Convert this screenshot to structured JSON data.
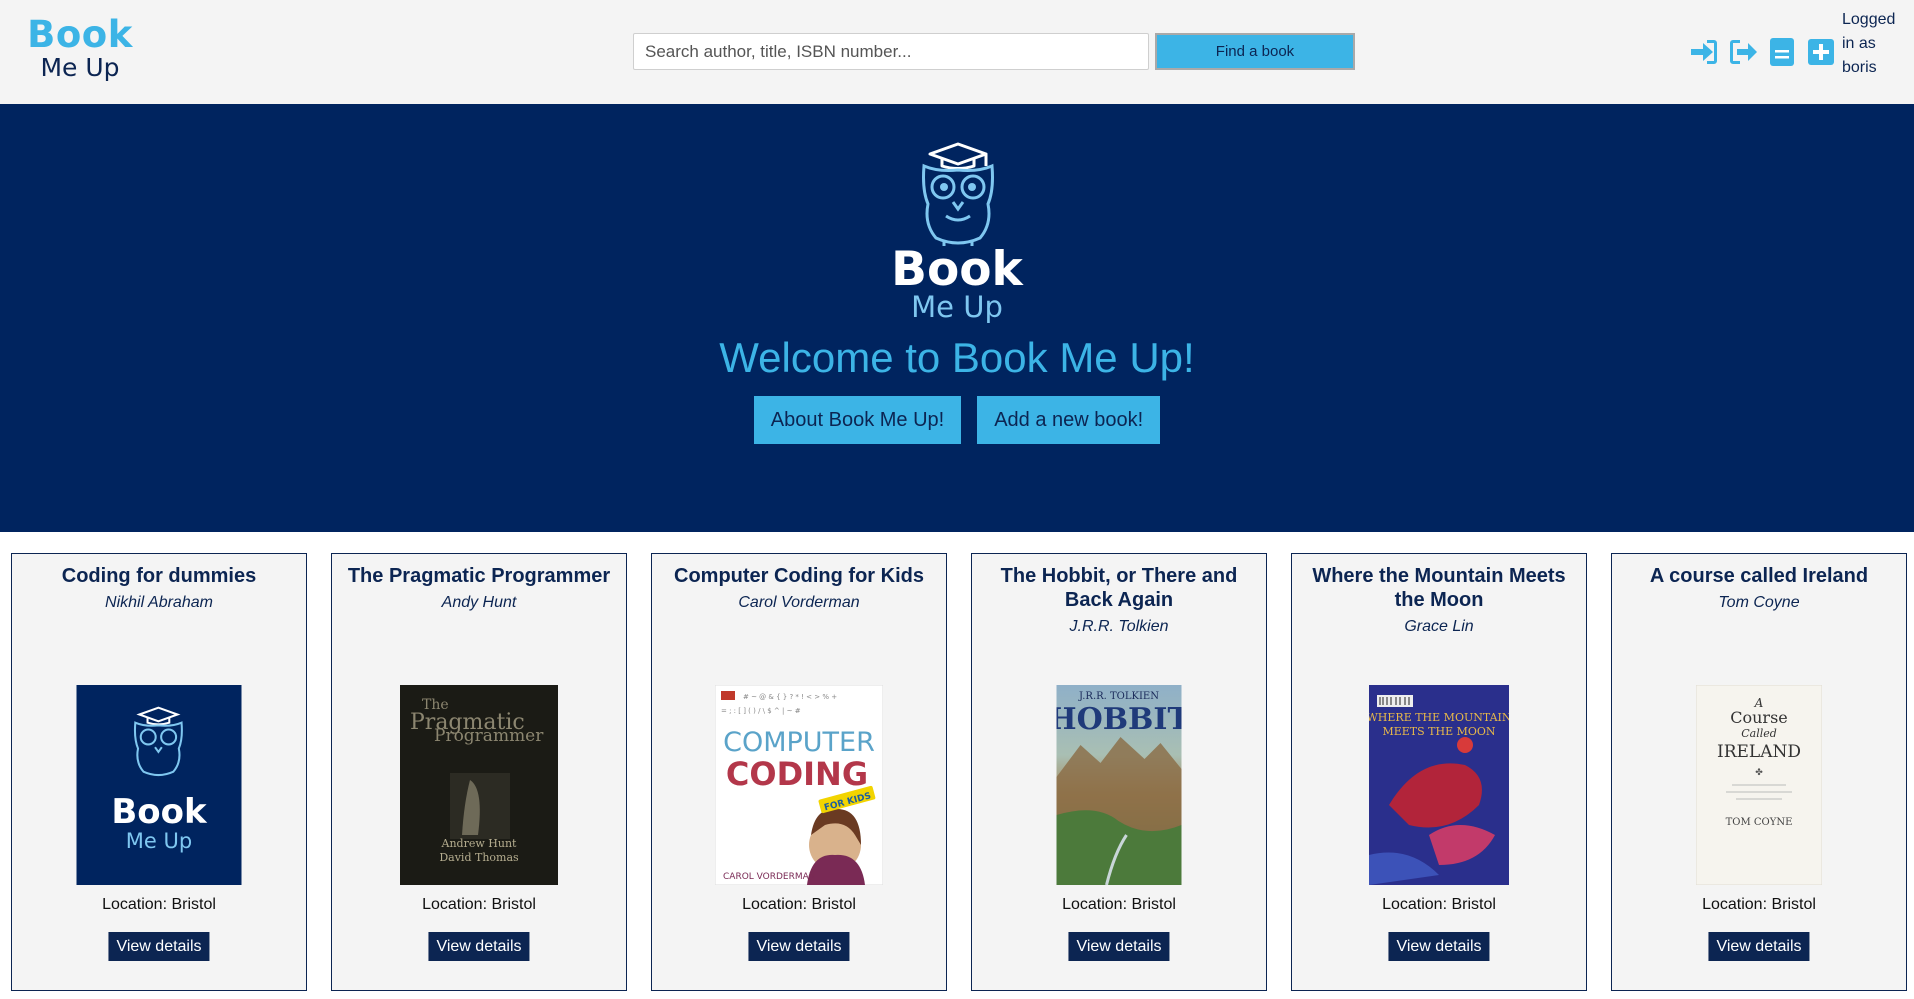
{
  "header": {
    "logo": {
      "line1": "Book",
      "line2": "Me Up"
    },
    "search": {
      "placeholder": "Search author, title, ISBN number..."
    },
    "find_button": "Find a book",
    "icons": [
      "sign-in-icon",
      "sign-out-icon",
      "list-icon",
      "plus-square-icon"
    ],
    "logged_in": "Logged in as boris"
  },
  "hero": {
    "logo_line1": "Book",
    "logo_line2": "Me Up",
    "title": "Welcome to Book Me Up!",
    "buttons": [
      "About Book Me Up!",
      "Add a new book!"
    ]
  },
  "books": [
    {
      "title": "Coding for dummies",
      "author": "Nikhil Abraham",
      "location": "Location: Bristol",
      "button": "View details",
      "cover": {
        "logo_line1": "Book",
        "logo_line2": "Me Up"
      }
    },
    {
      "title": "The Pragmatic Programmer",
      "author": "Andy Hunt",
      "location": "Location: Bristol",
      "button": "View details",
      "cover": {
        "line1": "The",
        "line2": "Pragmatic",
        "line3": "Programmer",
        "authors1": "Andrew Hunt",
        "authors2": "David Thomas"
      }
    },
    {
      "title": "Computer Coding for Kids",
      "author": "Carol Vorderman",
      "location": "Location: Bristol",
      "button": "View details",
      "cover": {
        "word1": "COMPUTER",
        "word2": "CODING",
        "badge": "FOR KIDS",
        "author": "CAROL VORDERMAN"
      }
    },
    {
      "title": "The Hobbit, or There and Back Again",
      "author": "J.R.R. Tolkien",
      "location": "Location: Bristol",
      "button": "View details",
      "cover": {
        "author": "J.R.R. TOLKIEN",
        "title": "HOBBIT"
      }
    },
    {
      "title": "Where the Mountain Meets the Moon",
      "author": "Grace Lin",
      "location": "Location: Bristol",
      "button": "View details",
      "cover": {
        "line1": "WHERE THE MOUNTAIN",
        "line2": "MEETS THE MOON"
      }
    },
    {
      "title": "A course called Ireland",
      "author": "Tom Coyne",
      "location": "Location: Bristol",
      "button": "View details",
      "cover": {
        "line1": "A",
        "line2": "Course",
        "line3": "Called",
        "line4": "IRELAND",
        "author": "TOM COYNE"
      }
    }
  ],
  "colors": {
    "navy": "#00245f",
    "accent": "#3cb4e6",
    "text_navy": "#0c2552",
    "card_bg": "#f4f4f4"
  }
}
